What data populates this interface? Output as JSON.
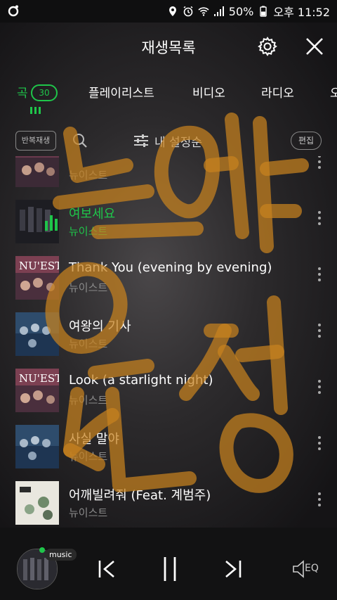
{
  "status_bar": {
    "battery": "50%",
    "time": "오후 11:52",
    "icons": [
      "app-icon",
      "location-icon",
      "alarm-icon",
      "wifi-icon",
      "signal-icon",
      "battery-icon"
    ]
  },
  "header": {
    "title": "재생목록",
    "settings_icon": "gear-icon",
    "close_icon": "close-icon"
  },
  "tabs": [
    {
      "label": "곡",
      "badge": "30",
      "active": true
    },
    {
      "label": "플레이리스트",
      "active": false
    },
    {
      "label": "비디오",
      "active": false
    },
    {
      "label": "라디오",
      "active": false
    },
    {
      "label": "오",
      "active": false
    }
  ],
  "toolbar": {
    "repeat_label": "반복재생",
    "sort_label": "내 설정순",
    "edit_label": "편집"
  },
  "songs": [
    {
      "title": "",
      "artist": "뉴이스트",
      "playing": false
    },
    {
      "title": "여보세요",
      "artist": "뉴이스트",
      "playing": true
    },
    {
      "title": "Thank You (evening by evening)",
      "artist": "뉴이스트",
      "playing": false
    },
    {
      "title": "여왕의 기사",
      "artist": "뉴이스트",
      "playing": false
    },
    {
      "title": "Look (a starlight night)",
      "artist": "뉴이스트",
      "playing": false
    },
    {
      "title": "사실 말야",
      "artist": "뉴이스트",
      "playing": false
    },
    {
      "title": "어깨빌려줘 (Feat. 계범주)",
      "artist": "뉴이스트",
      "playing": false
    }
  ],
  "player": {
    "badge": "music",
    "eq_label": "EQ"
  },
  "colors": {
    "accent": "#1fc54a",
    "watermark": "#c8821e"
  }
}
